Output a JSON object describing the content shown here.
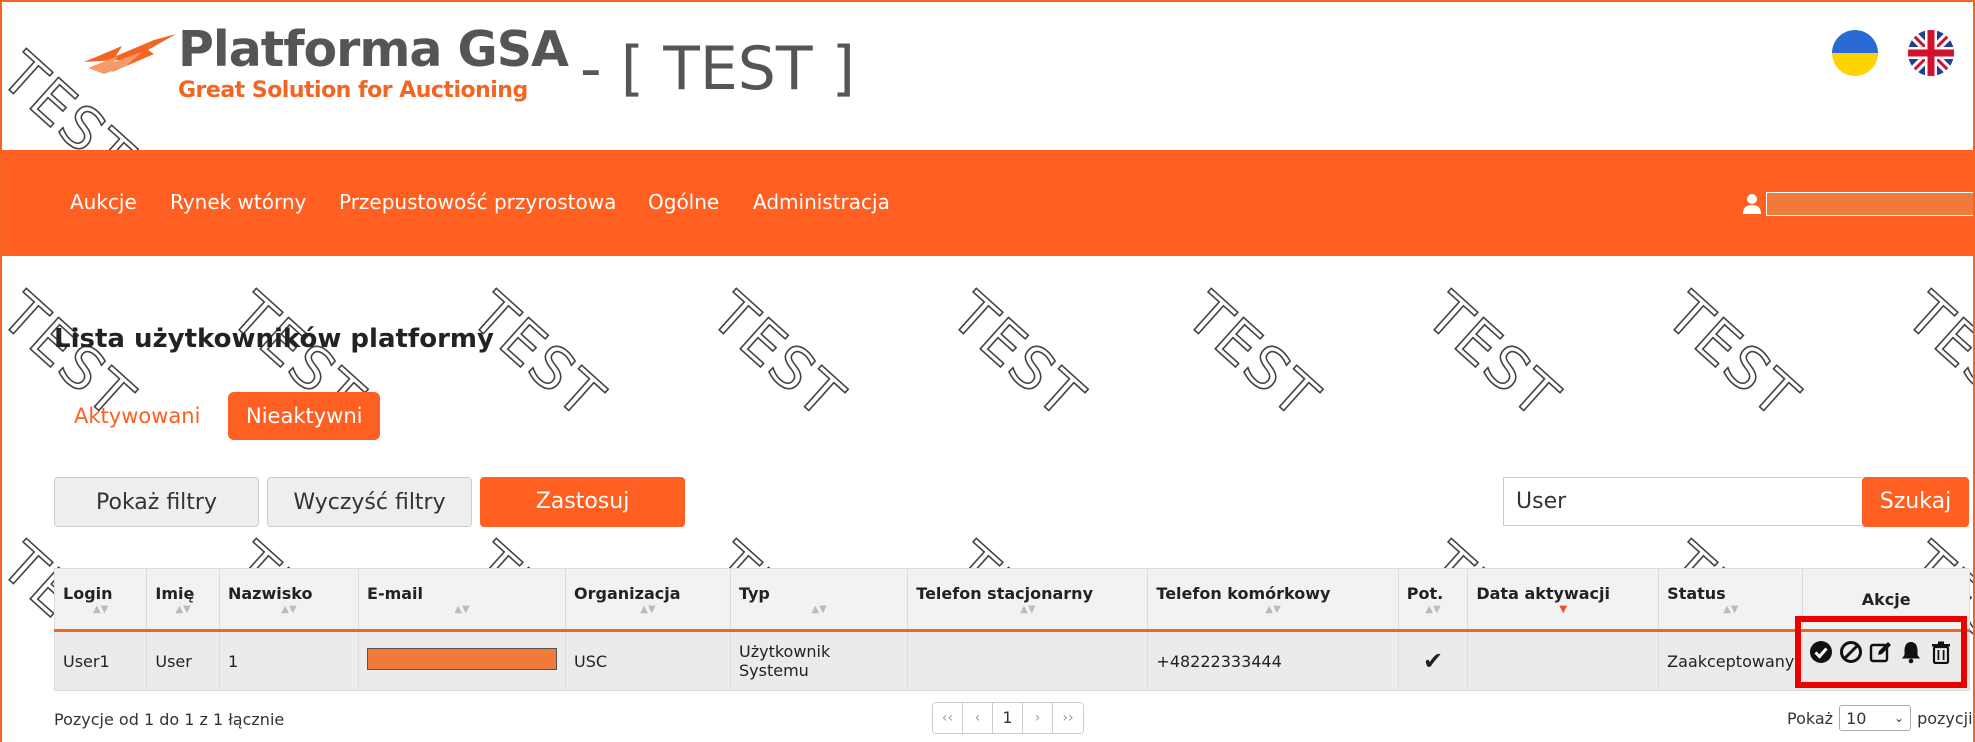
{
  "header": {
    "logo_title": "Platforma GSA",
    "logo_subtitle": "Great Solution for Auctioning",
    "environment": "- [ TEST ]",
    "flags": [
      "ukraine-flag-icon",
      "uk-flag-icon"
    ]
  },
  "nav": {
    "items": [
      "Aukcje",
      "Rynek wtórny",
      "Przepustowość przyrostowa",
      "Ogólne",
      "Administracja"
    ],
    "user_icon": "user-icon"
  },
  "watermark": "TEST",
  "page": {
    "title": "Lista użytkowników platformy",
    "tabs": [
      "Aktywowani",
      "Nieaktywni"
    ]
  },
  "toolbar": {
    "show_filters": "Pokaż filtry",
    "clear_filters": "Wyczyść filtry",
    "apply": "Zastosuj",
    "search_value": "User",
    "search_button": "Szukaj"
  },
  "table": {
    "columns": [
      "Login",
      "Imię",
      "Nazwisko",
      "E-mail",
      "Organizacja",
      "Typ",
      "Telefon stacjonarny",
      "Telefon komórkowy",
      "Pot.",
      "Data aktywacji",
      "Status",
      "Akcje"
    ],
    "rows": [
      {
        "login": "User1",
        "first_name": "User",
        "last_name": "1",
        "email": "",
        "organization": "USC",
        "type": "Użytkownik Systemu",
        "landline": "",
        "mobile": "+48222333444",
        "confirmed": "✔",
        "activation_date": "",
        "status": "Zaakceptowany"
      }
    ],
    "actions": [
      "approve-icon",
      "block-icon",
      "edit-icon",
      "bell-icon",
      "trash-icon"
    ]
  },
  "footer": {
    "info": "Pozycje od 1 do 1 z 1 łącznie",
    "pager": [
      "‹‹",
      "‹",
      "1",
      "›",
      "››"
    ],
    "show_label": "Pokaż",
    "page_size": "10",
    "items_label": "pozycji"
  },
  "colors": {
    "brand": "#ff5f20",
    "highlight": "#ee0000"
  }
}
